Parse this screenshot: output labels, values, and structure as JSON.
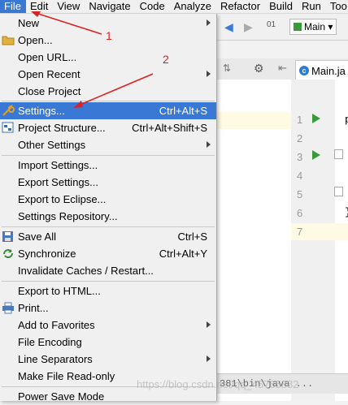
{
  "menubar": [
    "File",
    "Edit",
    "View",
    "Navigate",
    "Code",
    "Analyze",
    "Refactor",
    "Build",
    "Run",
    "Too"
  ],
  "toolbar": {
    "run_config": "Main"
  },
  "tab": {
    "label": "Main.ja"
  },
  "editor": {
    "line_numbers": [
      "1",
      "2",
      "3",
      "4",
      "5",
      "6",
      "7"
    ],
    "code_1": "p",
    "code_6": "}"
  },
  "status_path": "381\\bin\\java ...",
  "watermark": "https://blog.csdn.net/qq_45765882",
  "annotations": {
    "a1": "1",
    "a2": "2"
  },
  "menu": {
    "new": "New",
    "open": "Open...",
    "open_url": "Open URL...",
    "open_recent": "Open Recent",
    "close_project": "Close Project",
    "settings": "Settings...",
    "settings_sc": "Ctrl+Alt+S",
    "project_structure": "Project Structure...",
    "project_structure_sc": "Ctrl+Alt+Shift+S",
    "other_settings": "Other Settings",
    "import_settings": "Import Settings...",
    "export_settings": "Export Settings...",
    "export_eclipse": "Export to Eclipse...",
    "settings_repo": "Settings Repository...",
    "save_all": "Save All",
    "save_all_sc": "Ctrl+S",
    "synchronize": "Synchronize",
    "synchronize_sc": "Ctrl+Alt+Y",
    "invalidate": "Invalidate Caches / Restart...",
    "export_html": "Export to HTML...",
    "print": "Print...",
    "favorites": "Add to Favorites",
    "encoding": "File Encoding",
    "line_sep": "Line Separators",
    "read_only": "Make File Read-only",
    "power_save": "Power Save Mode"
  }
}
